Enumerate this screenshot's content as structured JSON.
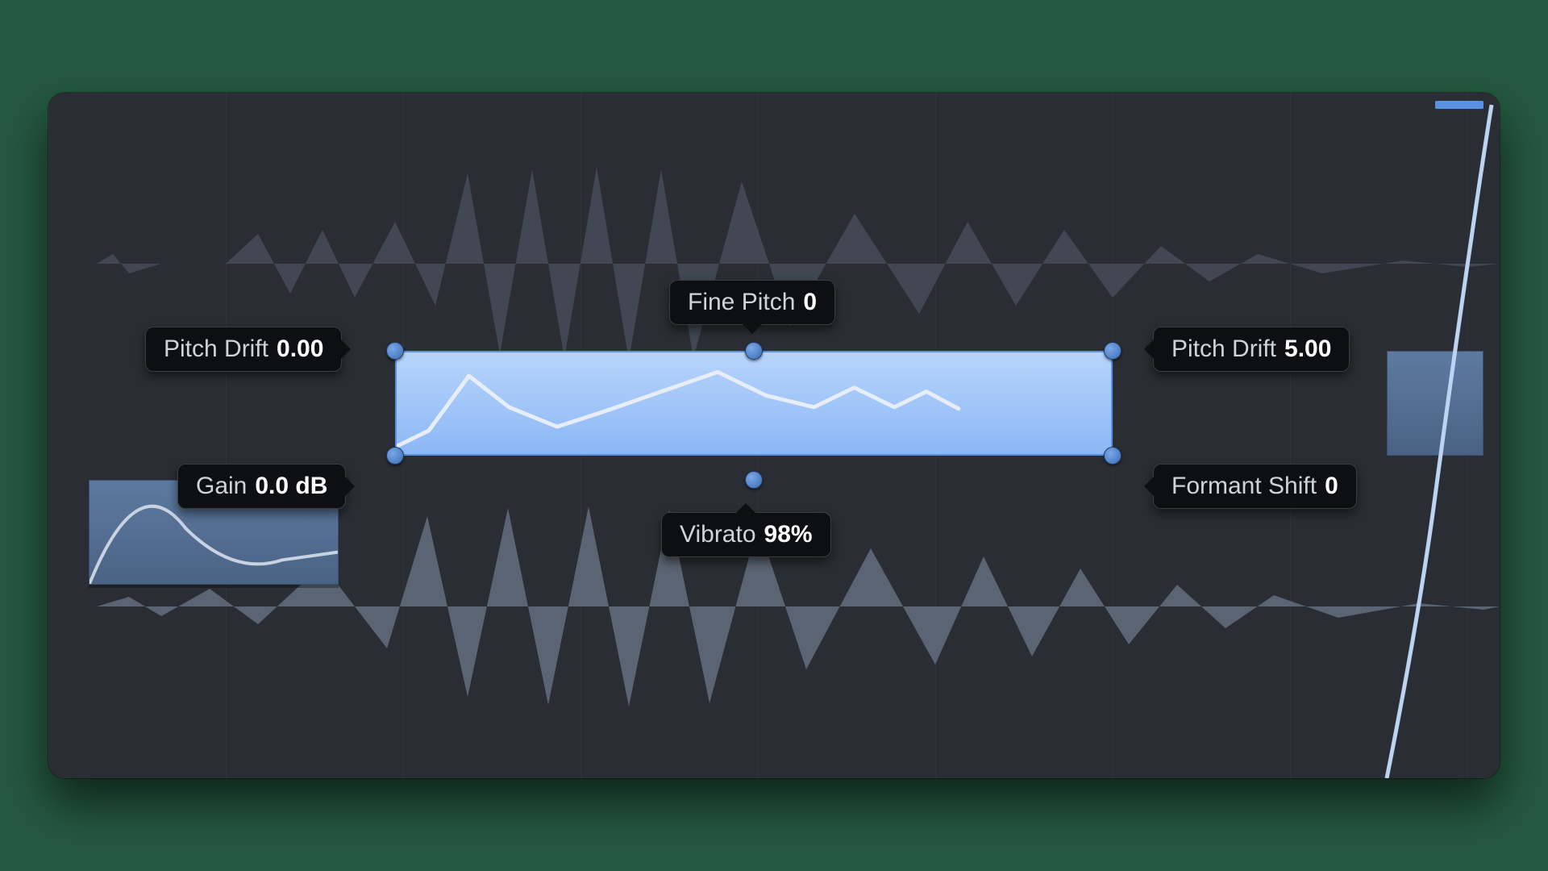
{
  "params": {
    "finePitch": {
      "label": "Fine Pitch",
      "value": "0"
    },
    "pitchDriftL": {
      "label": "Pitch Drift",
      "value": "0.00"
    },
    "pitchDriftR": {
      "label": "Pitch Drift",
      "value": "5.00"
    },
    "gain": {
      "label": "Gain",
      "value": "0.0 dB"
    },
    "vibrato": {
      "label": "Vibrato",
      "value": "98%"
    },
    "formant": {
      "label": "Formant Shift",
      "value": "0"
    }
  }
}
